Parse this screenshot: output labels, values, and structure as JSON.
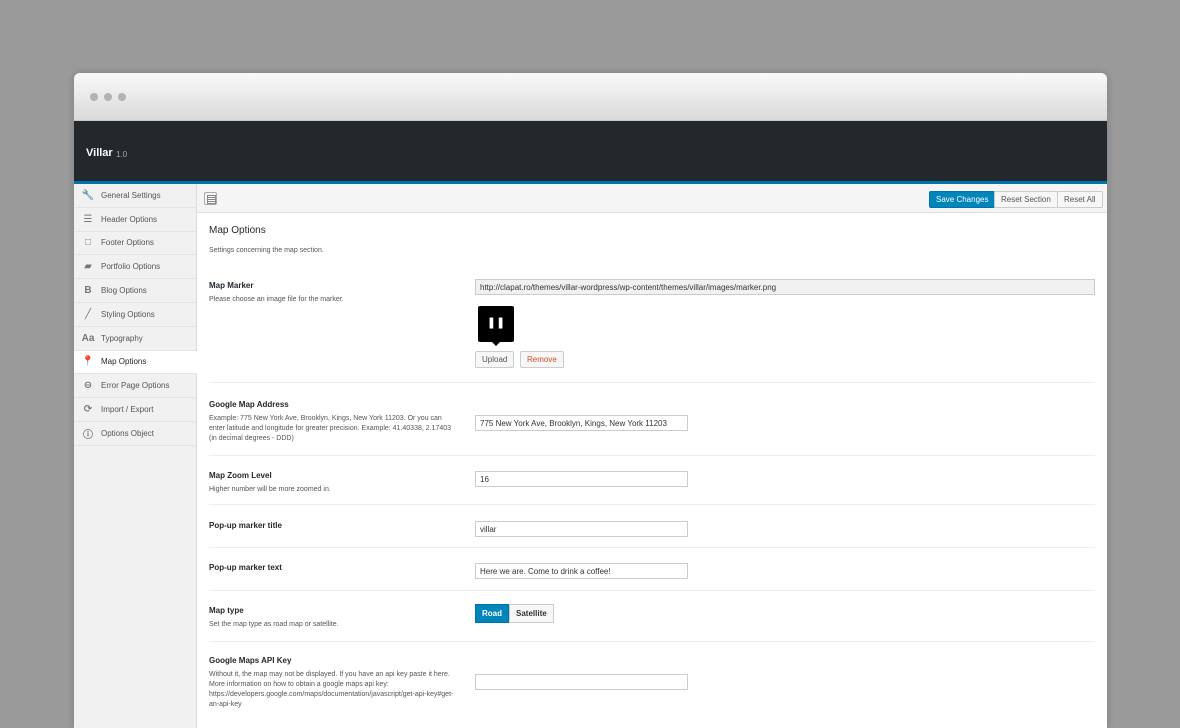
{
  "app": {
    "title": "Villar",
    "version": "1.0"
  },
  "sidebar": {
    "items": [
      {
        "label": "General Settings",
        "icon": "wrench-icon",
        "glyph": "🔧"
      },
      {
        "label": "Header Options",
        "icon": "menu-icon",
        "glyph": "☰"
      },
      {
        "label": "Footer Options",
        "icon": "square-icon",
        "glyph": "□"
      },
      {
        "label": "Portfolio Options",
        "icon": "folder-icon",
        "glyph": "▰"
      },
      {
        "label": "Blog Options",
        "icon": "blog-b-icon",
        "glyph": "B"
      },
      {
        "label": "Styling Options",
        "icon": "brush-icon",
        "glyph": "╱"
      },
      {
        "label": "Typography",
        "icon": "typography-icon",
        "glyph": "Aa"
      },
      {
        "label": "Map Options",
        "icon": "map-pin-icon",
        "glyph": "📍"
      },
      {
        "label": "Error Page Options",
        "icon": "minus-circle-icon",
        "glyph": "⊖"
      },
      {
        "label": "Import / Export",
        "icon": "refresh-icon",
        "glyph": "⟳"
      },
      {
        "label": "Options Object",
        "icon": "info-icon",
        "glyph": "ⓘ"
      }
    ],
    "active_index": 7
  },
  "toolbar": {
    "save_label": "Save Changes",
    "reset_section_label": "Reset Section",
    "reset_all_label": "Reset All"
  },
  "section": {
    "title": "Map Options",
    "description": "Settings concerning the map section."
  },
  "fields": {
    "map_marker": {
      "label": "Map Marker",
      "desc": "Please choose an image file for the marker.",
      "value": "http://clapat.ro/themes/villar-wordpress/wp-content/themes/villar/images/marker.png",
      "upload_label": "Upload",
      "remove_label": "Remove"
    },
    "address": {
      "label": "Google Map Address",
      "desc": "Example: 775 New York Ave, Brooklyn, Kings, New York 11203. Or you can enter latitude and longitude for greater precision. Example: 41.40338, 2.17403 (in decimal degrees - DDD)",
      "value": "775 New York Ave, Brooklyn, Kings, New York 11203"
    },
    "zoom": {
      "label": "Map Zoom Level",
      "desc": "Higher number will be more zoomed in.",
      "value": "16"
    },
    "popup_title": {
      "label": "Pop-up marker title",
      "value": "villar"
    },
    "popup_text": {
      "label": "Pop-up marker text",
      "value": "Here we are. Come to drink a coffee!"
    },
    "map_type": {
      "label": "Map type",
      "desc": "Set the map type as road map or satellite.",
      "options": [
        "Road",
        "Satellite"
      ],
      "selected": "Road"
    },
    "api_key": {
      "label": "Google Maps API Key",
      "desc": "Without it, the map may not be displayed. If you have an api key paste it here. More information on how to obtain a google maps api key: https://developers.google.com/maps/documentation/javascript/get-api-key#get-an-api-key",
      "value": ""
    }
  },
  "colors": {
    "accent": "#0085ba",
    "header_bg": "#23282d"
  }
}
